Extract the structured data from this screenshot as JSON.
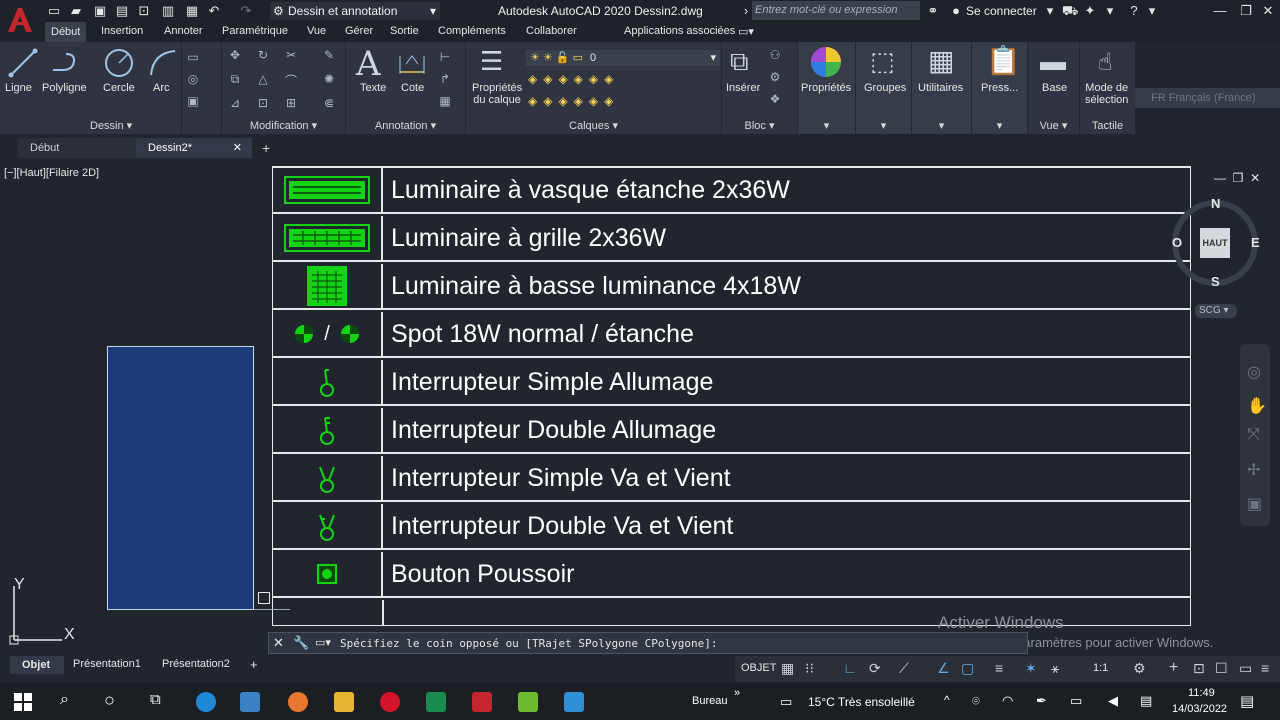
{
  "titlebar": {
    "app_logo": "A",
    "workspace": "Dessin et annotation",
    "title": "Autodesk AutoCAD 2020   Dessin2.dwg",
    "search_placeholder": "Entrez mot-clé ou expression",
    "signin": "Se connecter"
  },
  "ribbon_tabs": [
    "Début",
    "Insertion",
    "Annoter",
    "Paramétrique",
    "Vue",
    "Gérer",
    "Sortie",
    "Compléments",
    "Collaborer",
    "Applications associées"
  ],
  "ribbon": {
    "dessin": {
      "title": "Dessin",
      "ligne": "Ligne",
      "polyligne": "Polyligne",
      "cercle": "Cercle",
      "arc": "Arc"
    },
    "modification": {
      "title": "Modification"
    },
    "annotation": {
      "title": "Annotation",
      "texte": "Texte",
      "cote": "Cote"
    },
    "calques": {
      "title": "Calques",
      "proprietes": "Propriétés",
      "du_calque": "du calque",
      "layer": "0"
    },
    "bloc": {
      "title": "Bloc",
      "inserer": "Insérer"
    },
    "proprietes": "Propriétés",
    "groupes": "Groupes",
    "utilitaires": "Utilitaires",
    "press": "Press...",
    "vue": {
      "title": "Vue",
      "base": "Base"
    },
    "tactile": {
      "title": "Tactile",
      "mode": "Mode de",
      "selection": "sélection"
    },
    "language": "FR Français (France)"
  },
  "doc_tabs": {
    "debut": "Début",
    "dessin2": "Dessin2*",
    "add": "+"
  },
  "viewport_label": "[−][Haut][Filaire 2D]",
  "legend": [
    {
      "label": "Luminaire à vasque étanche 2x36W",
      "symbol": "vasque-icon"
    },
    {
      "label": "Luminaire à grille 2x36W",
      "symbol": "grille-icon"
    },
    {
      "label": "Luminaire à basse luminance 4x18W",
      "symbol": "basse-luminance-icon"
    },
    {
      "label": "Spot 18W normal / étanche",
      "symbol": "spot-icon",
      "sep": "/"
    },
    {
      "label": "Interrupteur Simple Allumage",
      "symbol": "interrupteur-simple-icon"
    },
    {
      "label": "Interrupteur Double Allumage",
      "symbol": "interrupteur-double-icon"
    },
    {
      "label": "Interrupteur Simple Va et Vient",
      "symbol": "va-et-vient-simple-icon"
    },
    {
      "label": "Interrupteur Double Va et Vient",
      "symbol": "va-et-vient-double-icon"
    },
    {
      "label": "Bouton Poussoir",
      "symbol": "bouton-poussoir-icon"
    }
  ],
  "viewcube": {
    "n": "N",
    "s": "S",
    "e": "E",
    "o": "O",
    "face": "HAUT",
    "scg": "SCG"
  },
  "ucs": {
    "y": "Y",
    "x": "X"
  },
  "activate": {
    "line1": "Activer Windows",
    "line2": "Accédez aux paramètres pour activer Windows."
  },
  "command": {
    "text": "Spécifiez le coin opposé ou [TRajet SPolygone CPolygone]:"
  },
  "layout_tabs": {
    "objet": "Objet",
    "p1": "Présentation1",
    "p2": "Présentation2",
    "add": "+"
  },
  "status": {
    "objet": "OBJET",
    "scale": "1:1"
  },
  "taskbar": {
    "bureau": "Bureau",
    "weather": "15°C  Très ensoleillé",
    "time": "11:49",
    "date": "14/03/2022"
  },
  "colors": {
    "accent_red": "#c4262e",
    "symbol_green": "#14d314",
    "ribbon_bg": "#2f3440",
    "canvas_bg": "#21252d"
  }
}
